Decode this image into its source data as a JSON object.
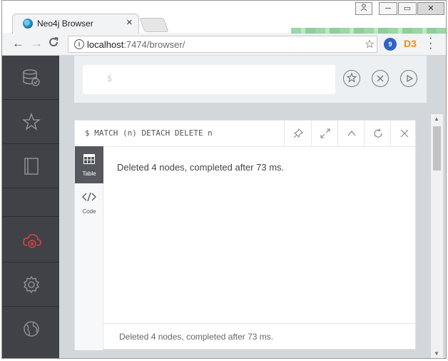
{
  "browser": {
    "tab_title": "Neo4j Browser",
    "tab_close": "×",
    "url_host": "localhost",
    "url_rest": ":7474/browser/",
    "window_controls": {
      "minimize": "─",
      "maximize": "▭",
      "close": "✕"
    }
  },
  "toolbar": {
    "back": "←",
    "forward": "→",
    "reload": "C",
    "bookmark": "☆",
    "ext2_label": "D3"
  },
  "sidebar": {
    "items": [
      {
        "name": "database-icon"
      },
      {
        "name": "favorites-star-icon"
      },
      {
        "name": "documents-book-icon"
      },
      {
        "name": "cloud-disconnected-icon"
      },
      {
        "name": "settings-gear-icon"
      },
      {
        "name": "about-icon"
      }
    ]
  },
  "editor": {
    "prompt": "$"
  },
  "frame": {
    "command": "$ MATCH (n) DETACH DELETE n",
    "tabs": [
      {
        "label": "Table"
      },
      {
        "label": "Code"
      }
    ],
    "result": "Deleted 4 nodes, completed after 73 ms.",
    "status": "Deleted 4 nodes, completed after 73 ms."
  },
  "colors": {
    "sidebar_bg": "#404247",
    "app_bg": "#d2d7db",
    "alert_red": "#e04343"
  }
}
